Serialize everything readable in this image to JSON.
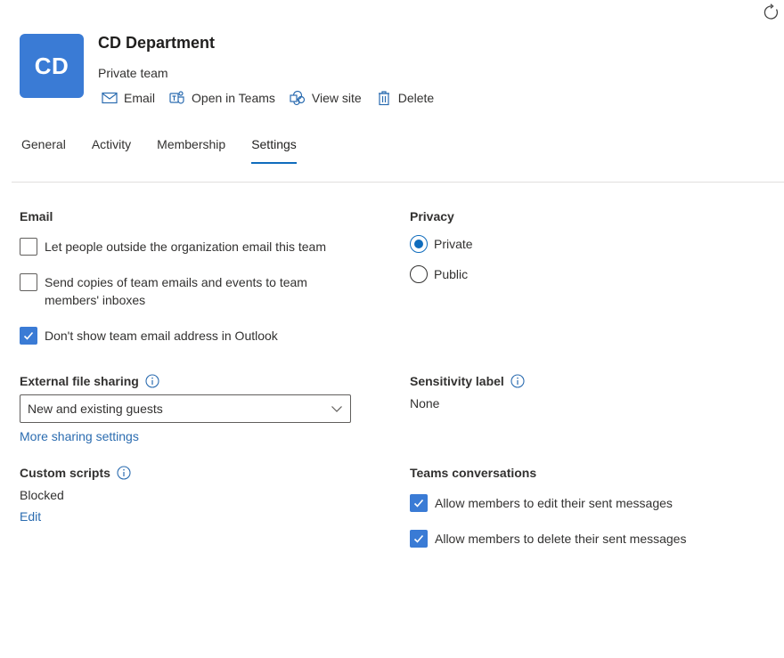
{
  "header": {
    "avatar_initials": "CD",
    "title": "CD Department",
    "subtitle": "Private team",
    "actions": [
      {
        "label": "Email",
        "icon": "mail-icon"
      },
      {
        "label": "Open in Teams",
        "icon": "teams-icon"
      },
      {
        "label": "View site",
        "icon": "sharepoint-icon"
      },
      {
        "label": "Delete",
        "icon": "trash-icon"
      }
    ],
    "refresh_icon": "refresh-icon"
  },
  "tabs": [
    {
      "label": "General",
      "active": false
    },
    {
      "label": "Activity",
      "active": false
    },
    {
      "label": "Membership",
      "active": false
    },
    {
      "label": "Settings",
      "active": true
    }
  ],
  "email": {
    "label": "Email",
    "options": [
      {
        "label": "Let people outside the organization email this team",
        "checked": false
      },
      {
        "label": "Send copies of team emails and events to team members' inboxes",
        "checked": false
      },
      {
        "label": "Don't show team email address in Outlook",
        "checked": true
      }
    ]
  },
  "privacy": {
    "label": "Privacy",
    "options": [
      {
        "label": "Private",
        "selected": true
      },
      {
        "label": "Public",
        "selected": false
      }
    ]
  },
  "external_sharing": {
    "label": "External file sharing",
    "value": "New and existing guests",
    "link": "More sharing settings"
  },
  "sensitivity": {
    "label": "Sensitivity label",
    "value": "None"
  },
  "custom_scripts": {
    "label": "Custom scripts",
    "value": "Blocked",
    "link": "Edit"
  },
  "teams_conversations": {
    "label": "Teams conversations",
    "options": [
      {
        "label": "Allow members to edit their sent messages",
        "checked": true
      },
      {
        "label": "Allow members to delete their sent messages",
        "checked": true
      }
    ]
  },
  "colors": {
    "accent": "#0f6cbd",
    "avatar": "#3a7bd5",
    "link": "#2b6cb0"
  }
}
